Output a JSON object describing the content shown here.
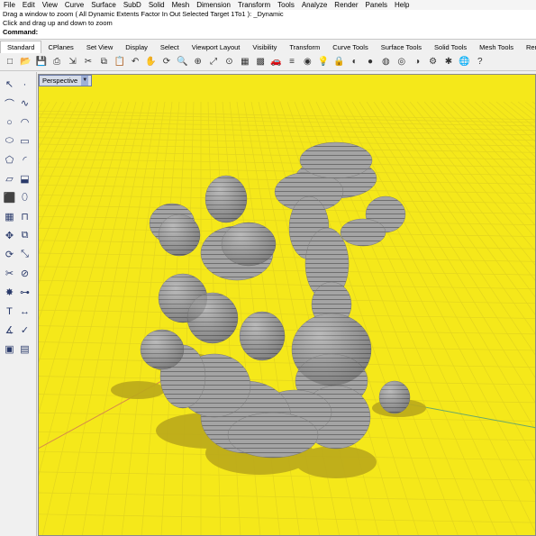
{
  "menu": [
    "File",
    "Edit",
    "View",
    "Curve",
    "Surface",
    "SubD",
    "Solid",
    "Mesh",
    "Dimension",
    "Transform",
    "Tools",
    "Analyze",
    "Render",
    "Panels",
    "Help"
  ],
  "command": {
    "history1": "Drag a window to zoom ( All  Dynamic  Extents  Factor  In  Out  Selected  Target  1To1 ): _Dynamic",
    "history2": "Click and drag up and down to zoom",
    "prompt": "Command:"
  },
  "tabs": [
    "Standard",
    "CPlanes",
    "Set View",
    "Display",
    "Select",
    "Viewport Layout",
    "Visibility",
    "Transform",
    "Curve Tools",
    "Surface Tools",
    "Solid Tools",
    "Mesh Tools",
    "Render"
  ],
  "active_tab": "Standard",
  "toolbar_icons": [
    "new-icon",
    "open-icon",
    "save-icon",
    "print-icon",
    "import-icon",
    "cut-icon",
    "copy-icon",
    "paste-icon",
    "undo-icon",
    "pan-icon",
    "rotate-icon",
    "zoom-dynamic-icon",
    "zoom-window-icon",
    "zoom-extents-icon",
    "zoom-selected-icon",
    "four-viewports-icon",
    "grid-icon",
    "car-icon",
    "layer-icon",
    "properties-icon",
    "lightbulb-icon",
    "lock-icon",
    "render-icon",
    "material-icon",
    "sphere-icon",
    "environment-icon",
    "shade-icon",
    "options-icon",
    "puzzle-icon",
    "globe-icon",
    "help-icon"
  ],
  "sidebar_icons": [
    "select-arrow-icon",
    "point-icon",
    "polyline-icon",
    "curve-icon",
    "circle-icon",
    "arc-icon",
    "ellipse-icon",
    "rectangle-icon",
    "polygon-icon",
    "fillet-icon",
    "surface-icon",
    "extrude-icon",
    "box-icon",
    "cylinder-icon",
    "mesh-icon",
    "boolean-icon",
    "move-icon",
    "copy-icon",
    "rotate-icon",
    "scale-icon",
    "trim-icon",
    "split-icon",
    "explode-icon",
    "join-icon",
    "text-icon",
    "dimension-icon",
    "analyze-icon",
    "check-icon",
    "block-icon",
    "group-icon"
  ],
  "viewport": {
    "title": "Perspective",
    "background": "#f5e81a",
    "object_color": "#9c9c9c"
  }
}
